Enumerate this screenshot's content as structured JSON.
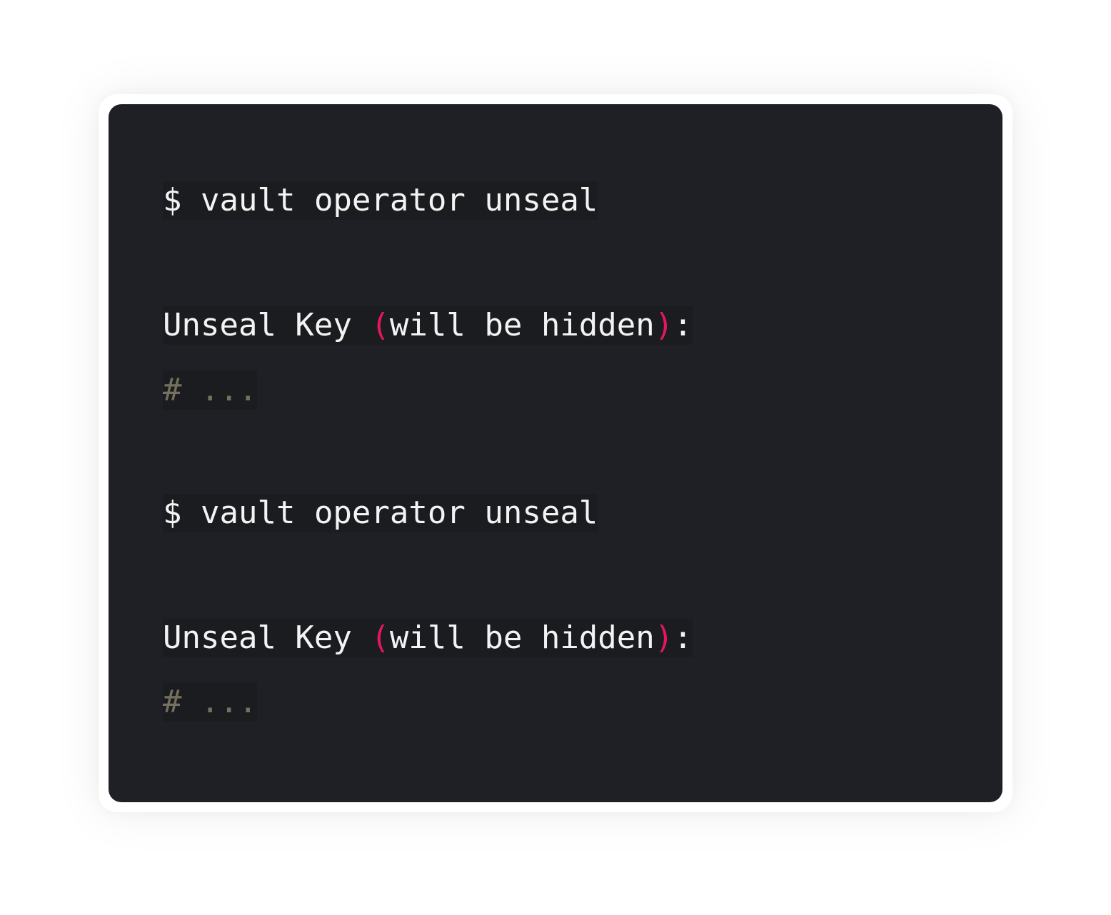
{
  "code_block": {
    "lines": [
      {
        "prompt": "$",
        "command": "vault operator unseal"
      },
      {
        "label_start": "Unseal Key",
        "open_paren": "(",
        "inner": "will be hidden",
        "close_paren": ")",
        "colon": ":"
      },
      {
        "comment": "# ..."
      },
      {
        "prompt": "$",
        "command": "vault operator unseal"
      },
      {
        "label_start": "Unseal Key",
        "open_paren": "(",
        "inner": "will be hidden",
        "close_paren": ")",
        "colon": ":"
      },
      {
        "comment": "# ..."
      }
    ]
  },
  "colors": {
    "background": "#1f2025",
    "text": "#f3f3f3",
    "paren": "#e2185b",
    "comment": "#75715e"
  }
}
